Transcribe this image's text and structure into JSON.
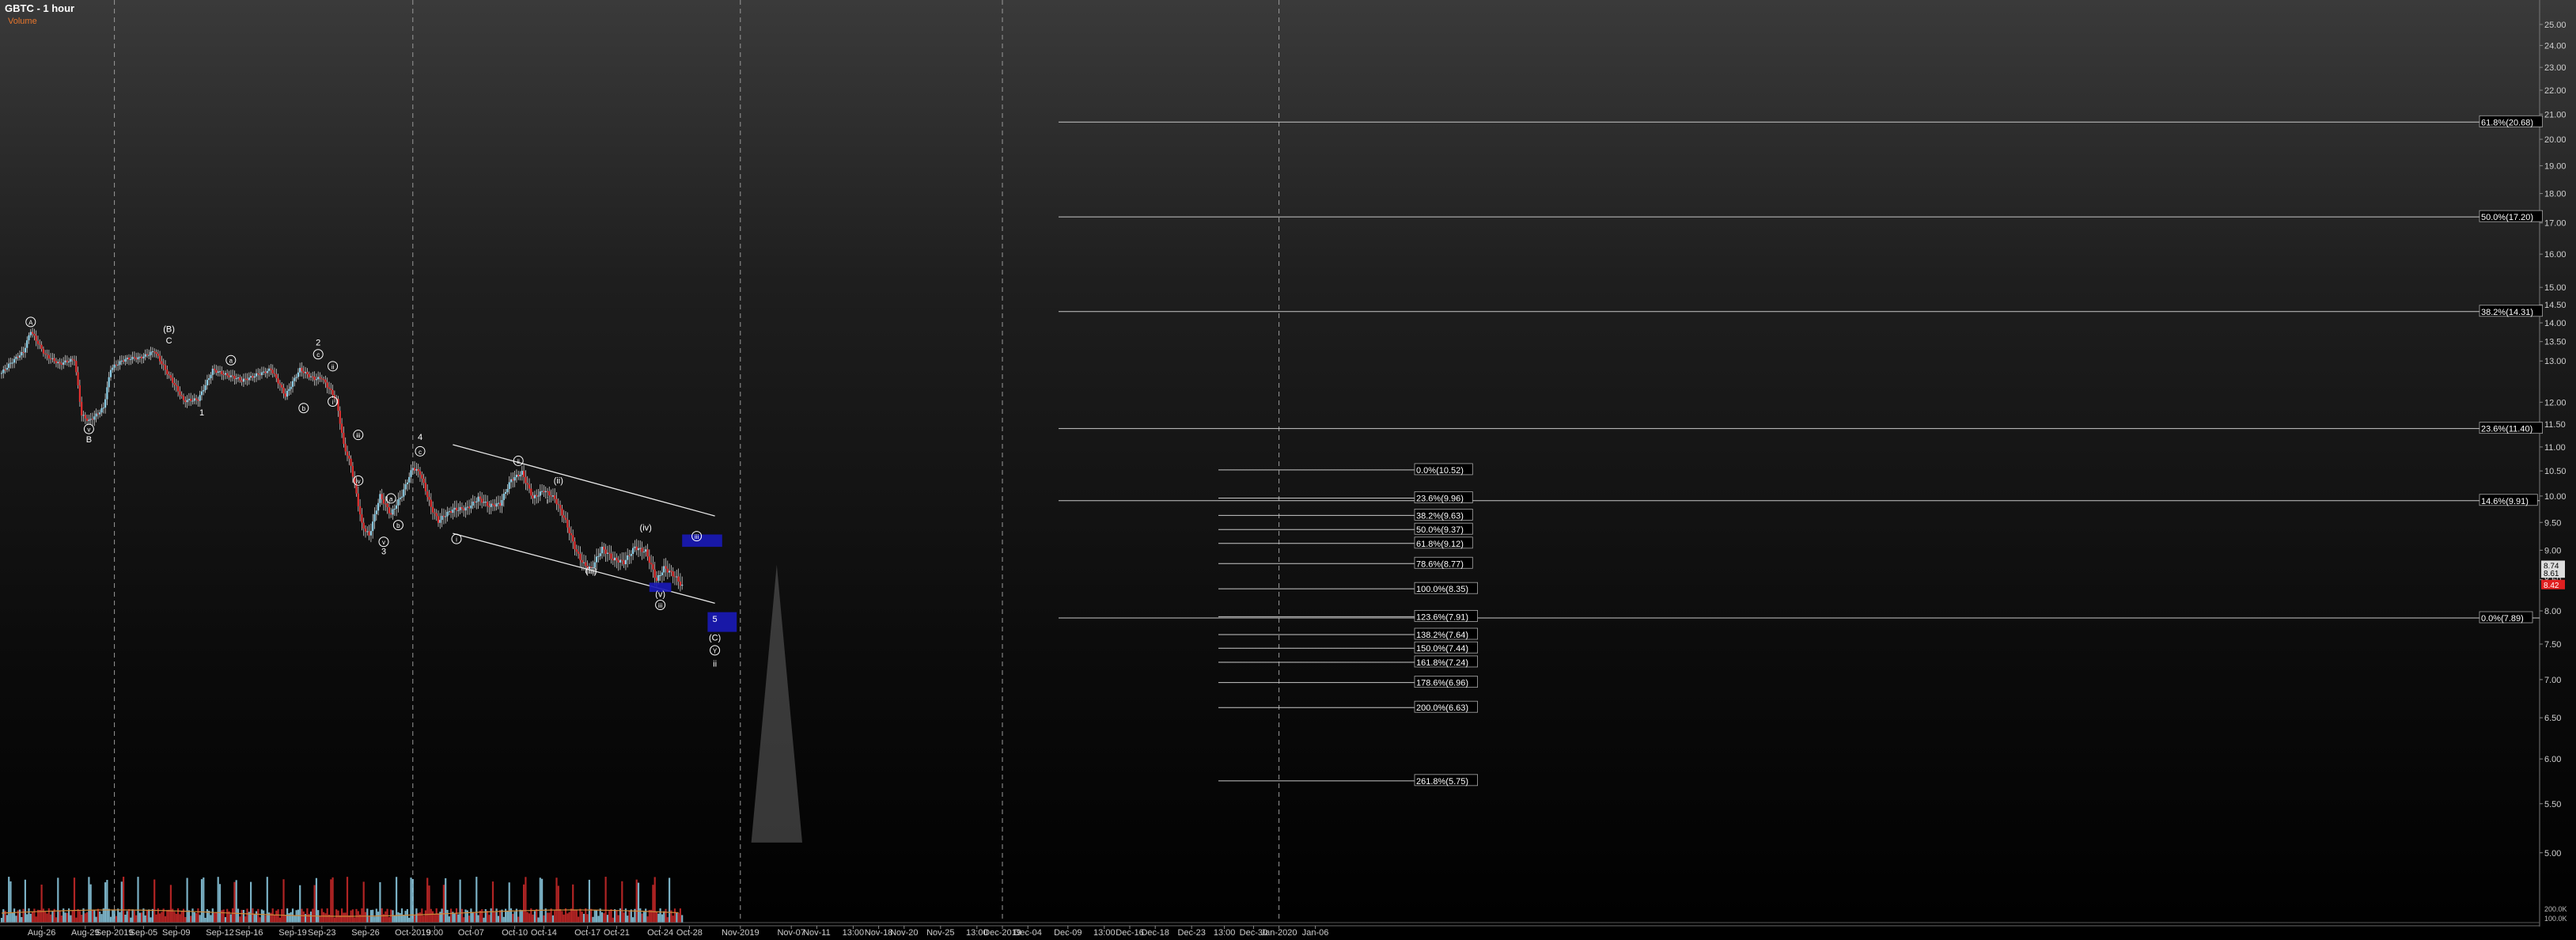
{
  "chart_data": {
    "type": "candlestick",
    "title": "GBTC - 1 hour",
    "subtitle": "Volume",
    "ylim": [
      4.7,
      25.5
    ],
    "log_scale": true,
    "price_ticks": [
      5.0,
      5.5,
      6.0,
      6.5,
      7.0,
      7.5,
      8.0,
      8.5,
      9.0,
      9.5,
      10.0,
      10.5,
      11.0,
      11.5,
      12.0,
      13.0,
      13.5,
      14.0,
      14.5,
      15.0,
      16.0,
      17.0,
      18.0,
      19.0,
      20.0,
      21.0,
      22.0,
      23.0,
      24.0,
      25.0
    ],
    "price_tick_labels": [
      "5.00",
      "5.50",
      "6.00",
      "6.50",
      "7.00",
      "7.50",
      "8.00",
      "8.50",
      "9.00",
      "9.50",
      "10.00",
      "10.50",
      "11.00",
      "11.50",
      "12.00",
      "13.00",
      "13.50",
      "14.00",
      "14.50",
      "15.00",
      "16.00",
      "17.00",
      "18.00",
      "19.00",
      "20.00",
      "21.00",
      "22.00",
      "23.00",
      "24.00",
      "25.00"
    ],
    "last_price_labels": [
      {
        "text": "8.74",
        "value": 8.74,
        "color": "#ffffff"
      },
      {
        "text": "8.61",
        "value": 8.61,
        "color": "#ffffff"
      },
      {
        "text": "8.42",
        "value": 8.42,
        "color": "#e02020"
      }
    ],
    "bars_to_shown": 195,
    "x_tick_labels": [
      {
        "label": "Aug-26",
        "bar": 11
      },
      {
        "label": "Aug-29",
        "bar": 23
      },
      {
        "label": "Sep-2019",
        "bar": 31
      },
      {
        "label": "Sep-05",
        "bar": 39
      },
      {
        "label": "Sep-09",
        "bar": 48
      },
      {
        "label": "Sep-12",
        "bar": 60
      },
      {
        "label": "Sep-16",
        "bar": 68
      },
      {
        "label": "Sep-19",
        "bar": 80
      },
      {
        "label": "Sep-23",
        "bar": 88
      },
      {
        "label": "Sep-26",
        "bar": 100
      },
      {
        "label": "Oct-2019",
        "bar": 113
      },
      {
        "label": "9:00",
        "bar": 119
      },
      {
        "label": "Oct-07",
        "bar": 129
      },
      {
        "label": "Oct-10",
        "bar": 141
      },
      {
        "label": "Oct-14",
        "bar": 149
      },
      {
        "label": "Oct-17",
        "bar": 161
      },
      {
        "label": "Oct-21",
        "bar": 169
      },
      {
        "label": "Oct-24",
        "bar": 181
      },
      {
        "label": "Oct-28",
        "bar": 189
      },
      {
        "label": "Nov-2019",
        "bar": 203
      },
      {
        "label": "Nov-07",
        "bar": 217
      },
      {
        "label": "Nov-11",
        "bar": 224
      },
      {
        "label": "13:00",
        "bar": 234
      },
      {
        "label": "Nov-18",
        "bar": 241
      },
      {
        "label": "Nov-20",
        "bar": 248
      },
      {
        "label": "Nov-25",
        "bar": 258
      },
      {
        "label": "13:00",
        "bar": 268
      },
      {
        "label": "Dec-2019",
        "bar": 275
      },
      {
        "label": "Dec-04",
        "bar": 282
      },
      {
        "label": "Dec-09",
        "bar": 293
      },
      {
        "label": "13:00",
        "bar": 303
      },
      {
        "label": "Dec-16",
        "bar": 310
      },
      {
        "label": "Dec-18",
        "bar": 317
      },
      {
        "label": "Dec-23",
        "bar": 327
      },
      {
        "label": "13:00",
        "bar": 336
      },
      {
        "label": "Dec-30",
        "bar": 344
      },
      {
        "label": "Jan-2020",
        "bar": 351
      },
      {
        "label": "Jan-06",
        "bar": 361
      }
    ],
    "month_separators": [
      31,
      113,
      203,
      275,
      351
    ],
    "volume_ticks": [
      {
        "text": "200.0K",
        "value": 200000
      },
      {
        "text": "100.0K",
        "value": 100000
      }
    ],
    "candles_ohlc_anchor": [
      [
        0,
        12.7
      ],
      [
        6,
        13.2
      ],
      [
        8,
        13.8
      ],
      [
        12,
        13.2
      ],
      [
        16,
        12.9
      ],
      [
        20,
        13.0
      ],
      [
        22,
        11.7
      ],
      [
        24,
        11.6
      ],
      [
        28,
        11.9
      ],
      [
        30,
        12.8
      ],
      [
        34,
        13.0
      ],
      [
        38,
        13.1
      ],
      [
        42,
        13.3
      ],
      [
        46,
        12.6
      ],
      [
        50,
        12.0
      ],
      [
        54,
        12.1
      ],
      [
        58,
        12.8
      ],
      [
        62,
        12.6
      ],
      [
        66,
        12.5
      ],
      [
        70,
        12.7
      ],
      [
        74,
        12.8
      ],
      [
        78,
        12.1
      ],
      [
        82,
        12.8
      ],
      [
        86,
        12.6
      ],
      [
        88,
        12.6
      ],
      [
        92,
        12.0
      ],
      [
        94,
        11.0
      ],
      [
        96,
        10.6
      ],
      [
        99,
        9.5
      ],
      [
        101,
        9.3
      ],
      [
        104,
        10.0
      ],
      [
        107,
        9.6
      ],
      [
        110,
        10.0
      ],
      [
        113,
        10.6
      ],
      [
        115,
        10.5
      ],
      [
        118,
        9.8
      ],
      [
        120,
        9.5
      ],
      [
        124,
        9.7
      ],
      [
        128,
        9.8
      ],
      [
        131,
        10.0
      ],
      [
        134,
        9.8
      ],
      [
        137,
        9.8
      ],
      [
        140,
        10.3
      ],
      [
        143,
        10.5
      ],
      [
        146,
        10.0
      ],
      [
        149,
        10.1
      ],
      [
        152,
        9.9
      ],
      [
        155,
        9.5
      ],
      [
        158,
        9.0
      ],
      [
        160,
        8.8
      ],
      [
        162,
        8.7
      ],
      [
        165,
        9.0
      ],
      [
        168,
        8.8
      ],
      [
        171,
        8.8
      ],
      [
        174,
        9.1
      ],
      [
        177,
        9.0
      ],
      [
        180,
        8.45
      ],
      [
        182,
        8.65
      ],
      [
        185,
        8.55
      ],
      [
        187,
        8.42
      ]
    ],
    "wave_labels": [
      {
        "text": "A",
        "circled": true,
        "bar": 8,
        "price": 13.95
      },
      {
        "text": "(B)",
        "circled": false,
        "bar": 46,
        "price": 13.75
      },
      {
        "text": "C",
        "circled": false,
        "bar": 46,
        "price": 13.45
      },
      {
        "text": "v",
        "circled": true,
        "bar": 24,
        "price": 11.33
      },
      {
        "text": "B",
        "circled": false,
        "bar": 24,
        "price": 11.1
      },
      {
        "text": "1",
        "circled": false,
        "bar": 55,
        "price": 11.7
      },
      {
        "text": "a",
        "circled": true,
        "bar": 63,
        "price": 12.95
      },
      {
        "text": "b",
        "circled": true,
        "bar": 83,
        "price": 11.8
      },
      {
        "text": "2",
        "circled": false,
        "bar": 87,
        "price": 13.4
      },
      {
        "text": "c",
        "circled": true,
        "bar": 87,
        "price": 13.1
      },
      {
        "text": "ii",
        "circled": true,
        "bar": 91,
        "price": 12.8
      },
      {
        "text": "i",
        "circled": true,
        "bar": 91,
        "price": 11.95
      },
      {
        "text": "iii",
        "circled": true,
        "bar": 98,
        "price": 11.2
      },
      {
        "text": "iv",
        "circled": true,
        "bar": 98,
        "price": 10.25
      },
      {
        "text": "a",
        "circled": true,
        "bar": 107,
        "price": 9.9
      },
      {
        "text": "b",
        "circled": true,
        "bar": 109,
        "price": 9.4
      },
      {
        "text": "v",
        "circled": true,
        "bar": 105,
        "price": 9.1
      },
      {
        "text": "3",
        "circled": false,
        "bar": 105,
        "price": 8.93
      },
      {
        "text": "4",
        "circled": false,
        "bar": 115,
        "price": 11.15
      },
      {
        "text": "c",
        "circled": true,
        "bar": 115,
        "price": 10.85
      },
      {
        "text": "i",
        "circled": true,
        "bar": 125,
        "price": 9.15
      },
      {
        "text": "ii",
        "circled": true,
        "bar": 142,
        "price": 10.65
      },
      {
        "text": "i",
        "circled": false,
        "bar": 150,
        "price": 9.85
      },
      {
        "text": "(ii)",
        "circled": false,
        "bar": 153,
        "price": 10.25
      },
      {
        "text": "(iii)",
        "circled": false,
        "bar": 162,
        "price": 8.6
      },
      {
        "text": "(iv)",
        "circled": false,
        "bar": 177,
        "price": 9.35
      },
      {
        "text": "iii",
        "circled": true,
        "bar": 191,
        "price": 9.2
      },
      {
        "text": "(v)",
        "circled": false,
        "bar": 181,
        "price": 8.22
      },
      {
        "text": "iii",
        "circled": true,
        "bar": 181,
        "price": 8.05
      },
      {
        "text": "5",
        "circled": false,
        "bar": 196,
        "price": 7.83
      },
      {
        "text": "(C)",
        "circled": false,
        "bar": 196,
        "price": 7.55
      },
      {
        "text": "Y",
        "circled": true,
        "bar": 196,
        "price": 7.37
      },
      {
        "text": "ii",
        "circled": false,
        "bar": 196,
        "price": 7.18
      }
    ],
    "channel_lines": [
      {
        "from": [
          124,
          11.05
        ],
        "to": [
          196,
          9.62
        ]
      },
      {
        "from": [
          124,
          9.3
        ],
        "to": [
          196,
          8.12
        ]
      }
    ],
    "target_boxes": [
      {
        "bar_from": 187,
        "bar_to": 198,
        "price_top": 9.28,
        "price_bottom": 9.06,
        "color": "#1a1ab8"
      },
      {
        "bar_from": 194,
        "bar_to": 202,
        "price_top": 7.98,
        "price_bottom": 7.68,
        "color": "#1a1ab8"
      },
      {
        "bar_from": 178,
        "bar_to": 184,
        "price_top": 8.45,
        "price_bottom": 8.3,
        "color": "#1a1ab8"
      }
    ],
    "fib_long": [
      {
        "text": "61.8%(20.68)",
        "value": 20.68
      },
      {
        "text": "50.0%(17.20)",
        "value": 17.2
      },
      {
        "text": "38.2%(14.31)",
        "value": 14.31
      },
      {
        "text": "23.6%(11.40)",
        "value": 11.4
      },
      {
        "text": "14.6%(9.91)",
        "value": 9.91
      },
      {
        "text": "0.0%(7.89)",
        "value": 7.89
      }
    ],
    "fib_short": [
      {
        "text": "0.0%(10.52)",
        "value": 10.52
      },
      {
        "text": "23.6%(9.96)",
        "value": 9.96
      },
      {
        "text": "38.2%(9.63)",
        "value": 9.63
      },
      {
        "text": "50.0%(9.37)",
        "value": 9.37
      },
      {
        "text": "61.8%(9.12)",
        "value": 9.12
      },
      {
        "text": "78.6%(8.77)",
        "value": 8.77
      },
      {
        "text": "100.0%(8.35)",
        "value": 8.35
      },
      {
        "text": "123.6%(7.91)",
        "value": 7.91
      },
      {
        "text": "138.2%(7.64)",
        "value": 7.64
      },
      {
        "text": "150.0%(7.44)",
        "value": 7.44
      },
      {
        "text": "161.8%(7.24)",
        "value": 7.24
      },
      {
        "text": "178.6%(6.96)",
        "value": 6.96
      },
      {
        "text": "200.0%(6.63)",
        "value": 6.63
      },
      {
        "text": "261.8%(5.75)",
        "value": 5.75
      }
    ],
    "projection_triangle": {
      "apex_bar": 213,
      "apex_price": 8.75,
      "base_left_bar": 206,
      "base_right_bar": 220,
      "base_price": 5.1
    }
  }
}
